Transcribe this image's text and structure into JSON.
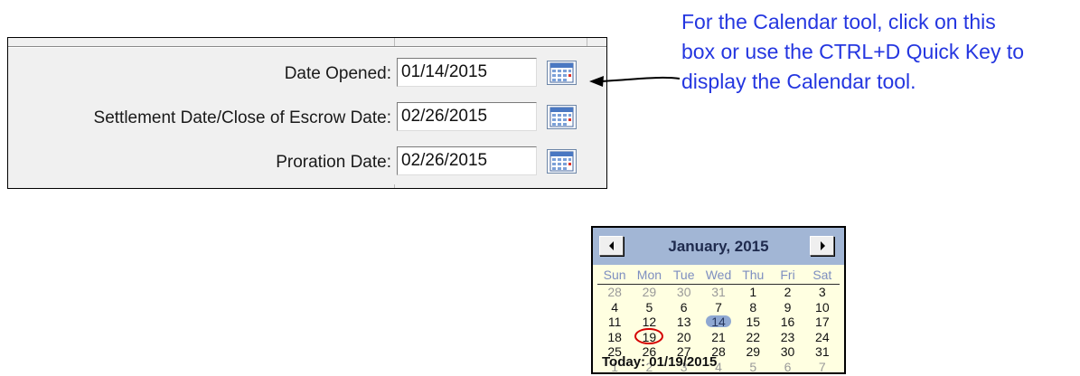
{
  "form": {
    "rows": [
      {
        "label": "Date Opened:",
        "value": "01/14/2015"
      },
      {
        "label": "Settlement Date/Close of Escrow Date:",
        "value": "02/26/2015"
      },
      {
        "label": "Proration Date:",
        "value": "02/26/2015"
      }
    ]
  },
  "callout": {
    "lines": [
      "For the Calendar tool, click on this",
      "box or use the CTRL+D Quick Key to",
      "display the Calendar tool."
    ],
    "color": "#2436e0"
  },
  "calendar": {
    "title": "January, 2015",
    "prev_icon": "triangle-left-icon",
    "next_icon": "triangle-right-icon",
    "weekdays": [
      "Sun",
      "Mon",
      "Tue",
      "Wed",
      "Thu",
      "Fri",
      "Sat"
    ],
    "weeks": [
      [
        "28",
        "29",
        "30",
        "31",
        "1",
        "2",
        "3"
      ],
      [
        "4",
        "5",
        "6",
        "7",
        "8",
        "9",
        "10"
      ],
      [
        "11",
        "12",
        "13",
        "14",
        "15",
        "16",
        "17"
      ],
      [
        "18",
        "19",
        "20",
        "21",
        "22",
        "23",
        "24"
      ],
      [
        "25",
        "26",
        "27",
        "28",
        "29",
        "30",
        "31"
      ],
      [
        "1",
        "2",
        "3",
        "4",
        "5",
        "6",
        "7"
      ]
    ],
    "selected_day": "14",
    "today_day": "19",
    "today_label": "Today: 01/19/2015",
    "header_color": "#a2b6d5",
    "body_color": "#ffffe1",
    "today_circle_color": "#d40000"
  }
}
